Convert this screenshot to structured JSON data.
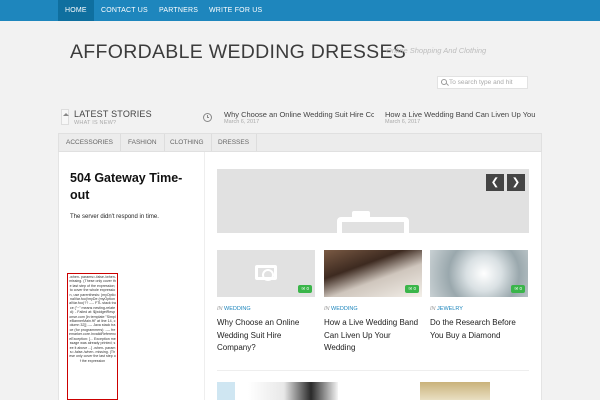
{
  "nav": {
    "items": [
      {
        "label": "HOME",
        "active": true
      },
      {
        "label": "CONTACT US"
      },
      {
        "label": "PARTNERS"
      },
      {
        "label": "WRITE FOR US"
      }
    ]
  },
  "header": {
    "title": "AFFORDABLE WEDDING DRESSES",
    "tagline": "Online Shopping And Clothing",
    "search_placeholder": "To search type and hit"
  },
  "latest": {
    "title": "LATEST STORIES",
    "subtitle": "WHAT IS NEW?",
    "stories": [
      {
        "title": "Why Choose an Online Wedding Suit Hire Company?",
        "date": "March 6, 2017"
      },
      {
        "title": "How a Live Wedding Band Can Liven Up Your Wedding",
        "date": "March 6, 2017"
      }
    ]
  },
  "categories": [
    "ACCESSORIES",
    "FASHION",
    "CLOTHING",
    "DRESSES"
  ],
  "error": {
    "title": "504 Gateway Time-out",
    "text": "The server didn't respond in time.",
    "debug": "-when- params=-false-/when- missing. (These only cover the last step of the expression; to cover the whole expression, use parenthesis: (myOptionalVar.foo)!myDe (myOptionalVar.foo)?? ---- FTL stack trace (\"~\" means nesting-related): - Failed at: ${widgetResponse.com [in template \"SimpleBannerMain.ftl\" at line 14, column 32]] ---- Java stack trace (for programmers): ---- freemarker.core.InvalidReferenceException: [... Exception message was already printed; see it above ...] -when- params=-false-/when- missing. (These only cover the last step of the expression"
  },
  "slider": {
    "prev_icon": "chevron-left-icon",
    "next_icon": "chevron-right-icon"
  },
  "posts": [
    {
      "category_prefix": "IN",
      "category": "WEDDING",
      "title": "Why Choose an Online Wedding Suit Hire Company?",
      "comments": "0"
    },
    {
      "category_prefix": "IN",
      "category": "WEDDING",
      "title": "How a Live Wedding Band Can Liven Up Your Wedding",
      "comments": "0"
    },
    {
      "category_prefix": "IN",
      "category": "JEWELRY",
      "title": "Do the Research Before You Buy a Diamond",
      "comments": "0"
    }
  ],
  "colors": {
    "accent": "#1e86bd",
    "badge": "#3ab54a"
  }
}
